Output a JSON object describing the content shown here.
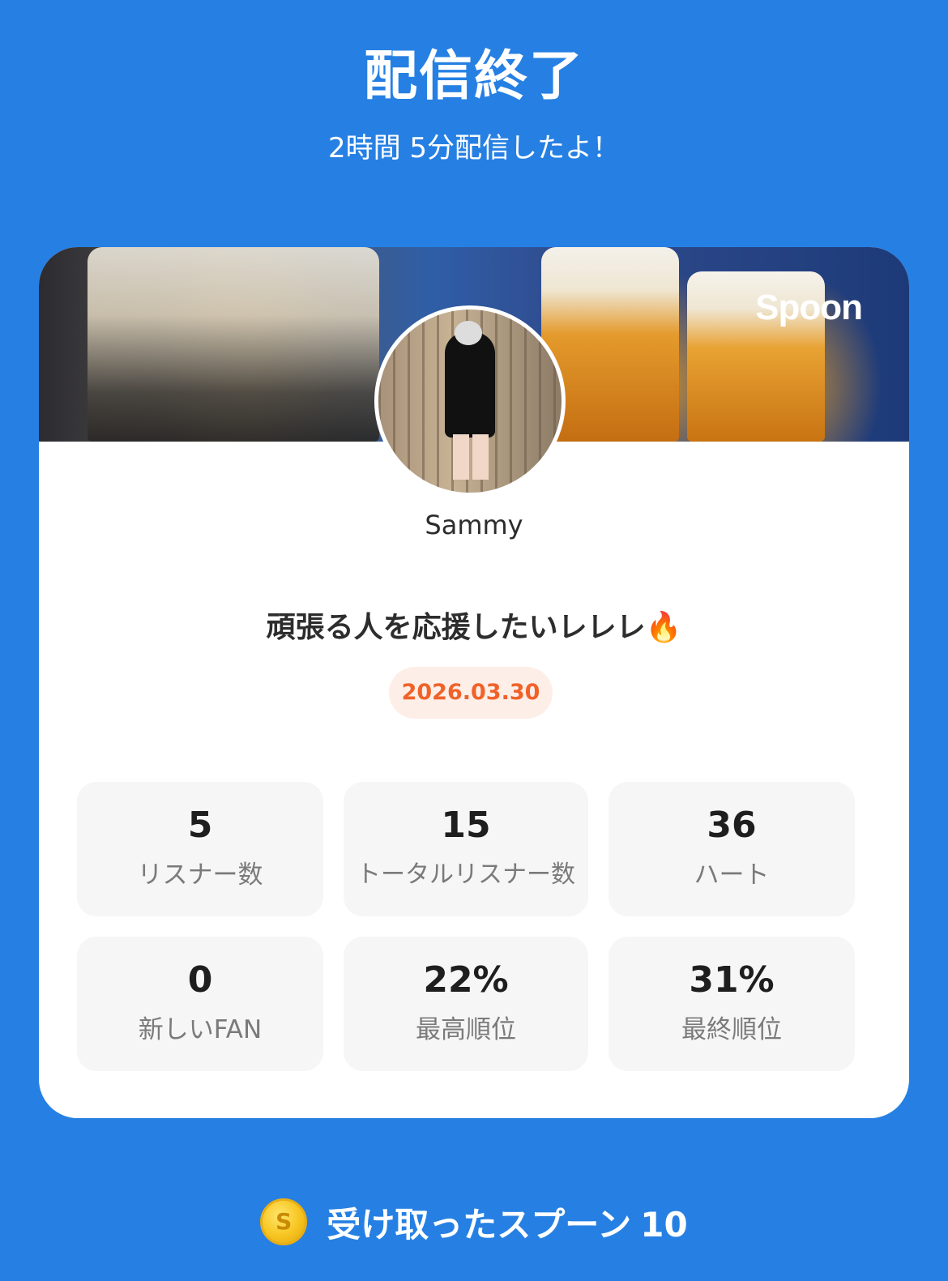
{
  "header": {
    "title": "配信終了",
    "subtitle": "2時間 5分配信したよ！"
  },
  "card": {
    "brand": "Spoon",
    "username": "Sammy",
    "headline": "頑張る人を応援したいレレレ🔥",
    "date": "2026.03.30"
  },
  "stats": [
    {
      "value": "5",
      "label": "リスナー数"
    },
    {
      "value": "15",
      "label": "トータルリスナー数"
    },
    {
      "value": "36",
      "label": "ハート"
    },
    {
      "value": "0",
      "label": "新しいFAN"
    },
    {
      "value": "22%",
      "label": "最高順位"
    },
    {
      "value": "31%",
      "label": "最終順位"
    }
  ],
  "footer": {
    "coin_symbol": "S",
    "label": "受け取ったスプーン",
    "count": "10"
  },
  "colors": {
    "background": "#2680e3",
    "date_text": "#f0622a",
    "date_bg": "#fdefe8"
  },
  "icons": [
    "coin-icon"
  ]
}
